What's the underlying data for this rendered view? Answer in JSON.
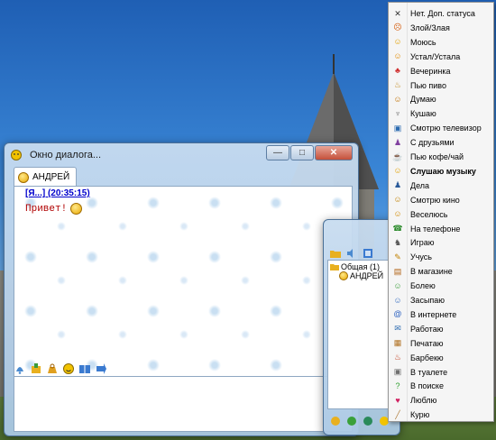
{
  "dialog": {
    "title": "Окно диалога...",
    "tab_label": "АНДРЕЙ",
    "message_header": "[Я...] (20:35:15)",
    "message_text": "Привет!",
    "controls": {
      "minimize": "—",
      "maximize": "□",
      "close": "✕"
    }
  },
  "contact_list": {
    "group_label": "Общая (1)",
    "contact_name": "АНДРЕЙ"
  },
  "status_menu": {
    "items": [
      {
        "label": "Нет. Доп. статуса",
        "icon": "x-icon",
        "glyph": "✕",
        "color": "#333333"
      },
      {
        "label": "Злой/Злая",
        "icon": "angry-icon",
        "glyph": "☹",
        "color": "#d45500"
      },
      {
        "label": "Моюсь",
        "icon": "bath-icon",
        "glyph": "☺",
        "color": "#e0a000"
      },
      {
        "label": "Устал/Устала",
        "icon": "tired-icon",
        "glyph": "☺",
        "color": "#e08a00"
      },
      {
        "label": "Вечеринка",
        "icon": "party-icon",
        "glyph": "♣",
        "color": "#d03030"
      },
      {
        "label": "Пью пиво",
        "icon": "beer-icon",
        "glyph": "♨",
        "color": "#c08a20"
      },
      {
        "label": "Думаю",
        "icon": "think-icon",
        "glyph": "☺",
        "color": "#c07000"
      },
      {
        "label": "Кушаю",
        "icon": "eat-icon",
        "glyph": "♆",
        "color": "#666666"
      },
      {
        "label": "Смотрю телевизор",
        "icon": "tv-icon",
        "glyph": "▣",
        "color": "#2a6ab0"
      },
      {
        "label": "С друзьями",
        "icon": "friends-icon",
        "glyph": "♟",
        "color": "#8040a0"
      },
      {
        "label": "Пью кофе/чай",
        "icon": "coffee-icon",
        "glyph": "☕",
        "color": "#7a4a20"
      },
      {
        "label": "Слушаю музыку",
        "icon": "music-icon",
        "glyph": "☺",
        "color": "#e0a000"
      },
      {
        "label": "Дела",
        "icon": "business-icon",
        "glyph": "♟",
        "color": "#2a5a9a"
      },
      {
        "label": "Смотрю кино",
        "icon": "movie-icon",
        "glyph": "☺",
        "color": "#c08000"
      },
      {
        "label": "Веселюсь",
        "icon": "fun-icon",
        "glyph": "☺",
        "color": "#d08a00"
      },
      {
        "label": "На телефоне",
        "icon": "phone-icon",
        "glyph": "☎",
        "color": "#2a8a2a"
      },
      {
        "label": "Играю",
        "icon": "game-icon",
        "glyph": "♞",
        "color": "#555555"
      },
      {
        "label": "Учусь",
        "icon": "study-icon",
        "glyph": "✎",
        "color": "#c08000"
      },
      {
        "label": "В магазине",
        "icon": "shop-icon",
        "glyph": "▤",
        "color": "#b06010"
      },
      {
        "label": "Болею",
        "icon": "sick-icon",
        "glyph": "☺",
        "color": "#40a040"
      },
      {
        "label": "Засыпаю",
        "icon": "sleep-icon",
        "glyph": "☺",
        "color": "#3a70c0"
      },
      {
        "label": "В интернете",
        "icon": "internet-icon",
        "glyph": "@",
        "color": "#2a60c0"
      },
      {
        "label": "Работаю",
        "icon": "work-icon",
        "glyph": "✉",
        "color": "#2a6ab0"
      },
      {
        "label": "Печатаю",
        "icon": "typing-icon",
        "glyph": "▦",
        "color": "#b07020"
      },
      {
        "label": "Барбекю",
        "icon": "bbq-icon",
        "glyph": "♨",
        "color": "#c04020"
      },
      {
        "label": "В туалете",
        "icon": "wc-icon",
        "glyph": "▣",
        "color": "#707070"
      },
      {
        "label": "В поиске",
        "icon": "search-status-icon",
        "glyph": "?",
        "color": "#30a030"
      },
      {
        "label": "Люблю",
        "icon": "love-icon",
        "glyph": "♥",
        "color": "#d02060"
      },
      {
        "label": "Курю",
        "icon": "smoke-icon",
        "glyph": "╱",
        "color": "#b08040"
      }
    ]
  }
}
